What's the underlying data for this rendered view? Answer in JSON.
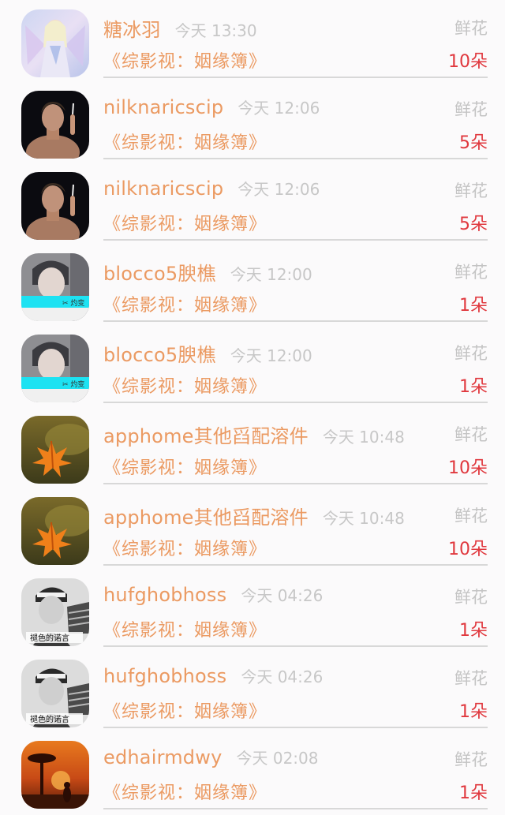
{
  "gift_records": [
    {
      "username": "糖冰羽",
      "time": "今天 13:30",
      "gift_label": "鲜花",
      "book": "《综影视：姻缘簿》",
      "amount": "10朵",
      "avatar_icon": "anime-angel-avatar-icon"
    },
    {
      "username": "nilknaricscip",
      "time": "今天 12:06",
      "gift_label": "鲜花",
      "book": "《综影视：姻缘簿》",
      "amount": "5朵",
      "avatar_icon": "person-smoking-avatar-icon"
    },
    {
      "username": "nilknaricscip",
      "time": "今天 12:06",
      "gift_label": "鲜花",
      "book": "《综影视：姻缘簿》",
      "amount": "5朵",
      "avatar_icon": "person-smoking-avatar-icon"
    },
    {
      "username": "blocco5腴樵",
      "time": "今天 12:00",
      "gift_label": "鲜花",
      "book": "《综影视：姻缘簿》",
      "amount": "1朵",
      "avatar_icon": "portrait-avatar-icon"
    },
    {
      "username": "blocco5腴樵",
      "time": "今天 12:00",
      "gift_label": "鲜花",
      "book": "《综影视：姻缘簿》",
      "amount": "1朵",
      "avatar_icon": "portrait-avatar-icon"
    },
    {
      "username": "apphome其他舀配溶件",
      "time": "今天 10:48",
      "gift_label": "鲜花",
      "book": "《综影视：姻缘簿》",
      "amount": "10朵",
      "avatar_icon": "maple-leaf-avatar-icon"
    },
    {
      "username": "apphome其他舀配溶件",
      "time": "今天 10:48",
      "gift_label": "鲜花",
      "book": "《综影视：姻缘簿》",
      "amount": "10朵",
      "avatar_icon": "maple-leaf-avatar-icon"
    },
    {
      "username": "hufghobhoss",
      "time": "今天 04:26",
      "gift_label": "鲜花",
      "book": "《综影视：姻缘簿》",
      "amount": "1朵",
      "avatar_icon": "bw-portrait-avatar-icon"
    },
    {
      "username": "hufghobhoss",
      "time": "今天 04:26",
      "gift_label": "鲜花",
      "book": "《综影视：姻缘簿》",
      "amount": "1朵",
      "avatar_icon": "bw-portrait-avatar-icon"
    },
    {
      "username": "edhairmdwy",
      "time": "今天 02:08",
      "gift_label": "鲜花",
      "book": "《综影视：姻缘簿》",
      "amount": "1朵",
      "avatar_icon": "sunset-tree-avatar-icon"
    }
  ],
  "avatar_text": {
    "portrait": "✂ 灼变",
    "bw_portrait": "褪色的诺言"
  },
  "colors": {
    "username": "#eb9a62",
    "amount": "#e0383e",
    "time": "#c7c7c7",
    "divider": "#d8d8d8"
  }
}
